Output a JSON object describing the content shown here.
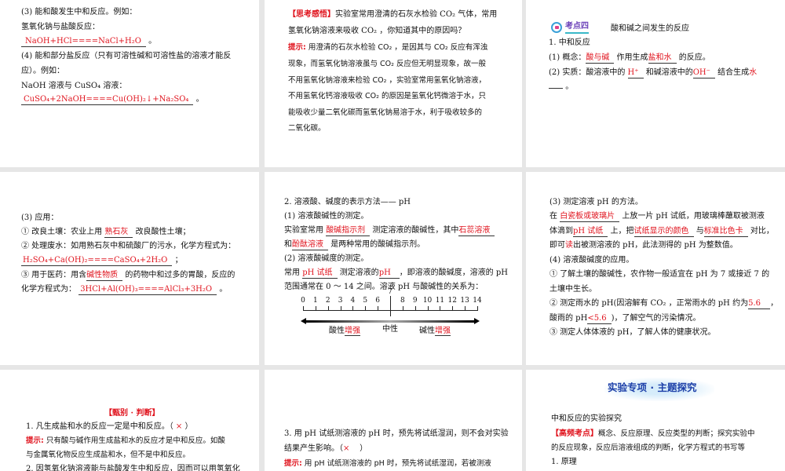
{
  "p1": {
    "l1": "(3) 能和酸发生中和反应。例如：",
    "l2": "氢氧化钠与盐酸反应：",
    "eq1": "NaOH+HCl====NaCl+H₂O",
    "dot": "。",
    "l4": "(4) 能和部分盐反应（只有可溶性碱和可溶性盐的溶液才能反",
    "l5": "应）。例如：",
    "l6": "NaOH 溶液与 CuSO₄ 溶液：",
    "eq2": "CuSO₄+2NaOH====Cu(OH)₂↓+Na₂SO₄"
  },
  "p2": {
    "tag": "【思考感悟】",
    "q1": "实验室常用澄清的石灰水检验 CO₂ 气体，常用",
    "q2": "氢氧化钠溶液来吸收 CO₂ ，你知道其中的原因吗？",
    "hint": "提示:",
    "h1": "用澄清的石灰水检验 CO₂ ，是因其与 CO₂ 反应有浑浊",
    "h2": "现象，而氢氧化钠溶液虽与 CO₂ 反应但无明显现象，故一般",
    "h3": "不用氢氧化钠溶液来检验 CO₂ ，实验室常用氢氧化钠溶液，",
    "h4": "不用氢氧化钙溶液吸收 CO₂ 的原因是氢氧化钙微溶于水，只",
    "h5": "能吸收少量二氧化碳而氢氧化钠易溶于水，利于吸收较多的",
    "h6": "二氧化碳。"
  },
  "p3": {
    "badge": "考点四",
    "title": "酸和碱之间发生的反应",
    "l1": "1. 中和反应",
    "l2a": "(1) 概念：",
    "b1": "酸与碱",
    "l2b": "作用生成",
    "b2": "盐和水",
    "l2c": "的反应。",
    "l3a": "(2) 实质：酸溶液中的",
    "b3": "H⁺",
    "l3b": "和碱溶液中的",
    "b4": "OH⁻",
    "l3c": "结合生成",
    "b5": "水",
    "end": "。"
  },
  "p4": {
    "l1": "(3) 应用：",
    "l2a": "① 改良土壤：农业上用",
    "b1": "熟石灰",
    "l2b": "改良酸性土壤；",
    "l3": "② 处理废水：如用熟石灰中和硫酸厂的污水，化学方程式为：",
    "eq1": "H₂SO₄+Ca(OH)₂====CaSO₄+2H₂O",
    "semi": "；",
    "l5a": "③ 用于医药：用含",
    "b2": "碱性物质",
    "l5b": "的药物中和过多的胃酸，反应的",
    "l6a": "化学方程式为：",
    "eq2": "3HCl+Al(OH)₃====AlCl₃+3H₂O",
    "dot": "。"
  },
  "p5": {
    "l1": "2. 溶液酸、碱度的表示方法—— pH",
    "l2": "(1) 溶液酸碱性的测定。",
    "l3a": "实验室常用",
    "b1": "酸碱指示剂",
    "l3b": "测定溶液的酸碱性，其中",
    "b2": "石蕊溶液",
    "l4a": "和",
    "b3": "酚酞溶液",
    "l4b": "是两种常用的酸碱指示剂。",
    "l5": "(2) 溶液酸碱度的测定。",
    "l6a": "常用",
    "b4": "pH 试纸",
    "l6b": "测定溶液的",
    "b5": "pH",
    "l6c": "，即溶液的酸碱度，溶液的 pH",
    "l7": "范围通常在 0 ～ 14 之间。溶液 pH 与酸碱性的关系为：",
    "scale": {
      "ticks": [
        "0",
        "1",
        "2",
        "3",
        "4",
        "5",
        "6",
        "7",
        "8",
        "9",
        "10",
        "11",
        "12",
        "13",
        "14"
      ],
      "acid": "酸性",
      "acid_b": "增强",
      "neutral": "中性",
      "base": "碱性",
      "base_b": "增强"
    }
  },
  "p6": {
    "l1": "(3) 测定溶液 pH 的方法。",
    "l2a": "在",
    "b1": "白瓷板或玻璃片",
    "l2b": "上放一片 pH 试纸，用玻璃棒蘸取被测液",
    "l3a": "体滴到",
    "b2": "pH 试纸",
    "l3b": "上，把",
    "b3": "试纸显示的颜色",
    "l3c": "与",
    "b4": "标准比色卡",
    "l3d": "对比，",
    "l4a": "即可",
    "b5": "读",
    "l4b": "出被测溶液的 pH，此法测得的 pH 为整数值。",
    "l5": "(4) 溶液酸碱度的应用。",
    "l6": "① 了解土壤的酸碱性，农作物一般适宜在 pH 为 7 或接近 7 的",
    "l7": "土壤中生长。",
    "l8a": "② 测定雨水的 pH(因溶解有 CO₂ ，正常雨水的 pH 约为",
    "b6": "5.6",
    "l8b": "，",
    "l9a": "酸雨的 pH",
    "b7": "<5.6",
    "l9b": ")，了解空气的污染情况。",
    "l10": "③ 测定人体体液的 pH，了解人体的健康状况。"
  },
  "p7": {
    "title": "【甄别 · 判断】",
    "q1a": "1. 凡生成盐和水的反应一定是中和反应。（",
    "mark": "×",
    "q1b": "）",
    "hint": "提示:",
    "h1": "只有酸与碱作用生成盐和水的反应才是中和反应。如酸",
    "h2": "与金属氧化物反应生成盐和水，但不是中和反应。",
    "q2": "2. 因氢氧化钠溶液能与盐酸发生中和反应，因而可以用氢氧化"
  },
  "p8": {
    "q3a": "3. 用 pH 试纸测溶液的 pH 时，预先将试纸湿润，则不会对实验",
    "q3b": "结果产生影响。（",
    "mark": "×",
    "q3c": "）",
    "hint": "提示:",
    "h1": "用 pH 试纸测溶液的 pH 时，预先将试纸湿润，若被测液"
  },
  "p9": {
    "banner": "实验专项 · 主题探究",
    "l1": "中和反应的实验探究",
    "tag": "【高频考点】",
    "l2": "概念、反应原理、反应类型的判断；探究实验中",
    "l3": "的反应现象，反应后溶液组成的判断，化学方程式的书写等",
    "l4": "1. 原理"
  }
}
